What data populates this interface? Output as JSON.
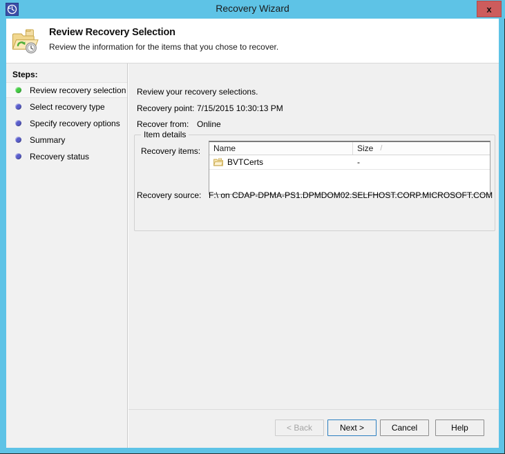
{
  "window": {
    "title": "Recovery Wizard",
    "title_icon": "recovery-clock-icon",
    "close_label": "x",
    "accent_color": "#5ec3e6",
    "close_color": "#cd5c5c"
  },
  "header": {
    "icon": "folder-recovery-icon",
    "title": "Review Recovery Selection",
    "subtitle": "Review the information for the items that you chose to recover."
  },
  "sidebar": {
    "heading": "Steps:",
    "items": [
      {
        "label": "Review recovery selection",
        "state": "current",
        "bullet_color": "#44cc44"
      },
      {
        "label": "Select recovery type",
        "state": "pending",
        "bullet_color": "#5a5ecb"
      },
      {
        "label": "Specify recovery options",
        "state": "pending",
        "bullet_color": "#5a5ecb"
      },
      {
        "label": "Summary",
        "state": "pending",
        "bullet_color": "#5a5ecb"
      },
      {
        "label": "Recovery status",
        "state": "pending",
        "bullet_color": "#5a5ecb"
      }
    ]
  },
  "main": {
    "intro": "Review your recovery selections.",
    "recovery_point_label": "Recovery point:",
    "recovery_point_value": "7/15/2015 10:30:13 PM",
    "recover_from_label": "Recover from:",
    "recover_from_value": "Online",
    "group_legend": "Item details",
    "recovery_items_label": "Recovery items:",
    "recovery_source_label": "Recovery source:",
    "recovery_source_value": "F:\\ on CDAP-DPMA-PS1.DPMDOM02.SELFHOST.CORP.MICROSOFT.COM",
    "listview": {
      "columns": [
        {
          "label": "Name",
          "sort_indicator": ""
        },
        {
          "label": "Size",
          "sort_indicator": "/"
        }
      ],
      "rows": [
        {
          "icon": "folder-icon",
          "name": "BVTCerts",
          "size": "-"
        }
      ]
    }
  },
  "buttons": {
    "back": {
      "label": "< Back",
      "enabled": false
    },
    "next": {
      "label": "Next >",
      "enabled": true,
      "default": true
    },
    "cancel": {
      "label": "Cancel",
      "enabled": true
    },
    "help": {
      "label": "Help",
      "enabled": true
    }
  }
}
